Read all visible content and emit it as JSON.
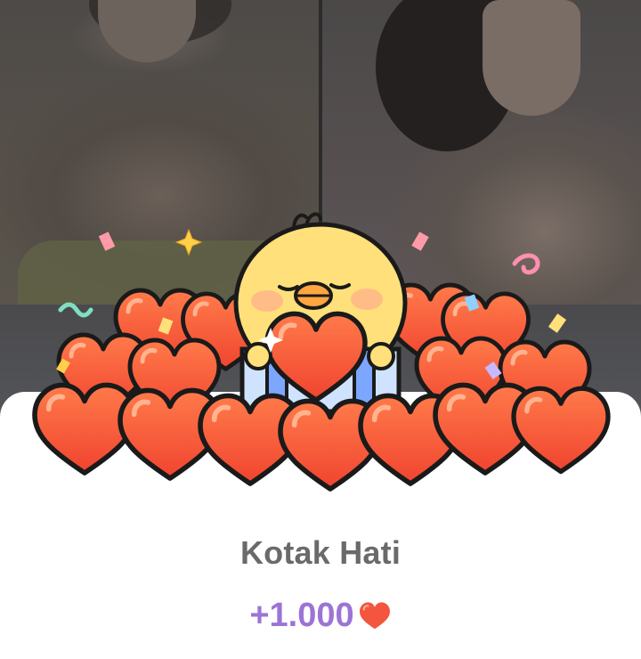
{
  "reward_popup": {
    "title": "Kotak Hati",
    "amount": "+1.000",
    "currency_icon": "heart-icon"
  },
  "colors": {
    "title": "#6a6a6a",
    "amount": "#9b74d6",
    "heart_fill": "#f4553f",
    "card": "#ffffff"
  },
  "background": {
    "tiles": [
      "photo-left",
      "photo-right",
      "photo-lower"
    ]
  }
}
